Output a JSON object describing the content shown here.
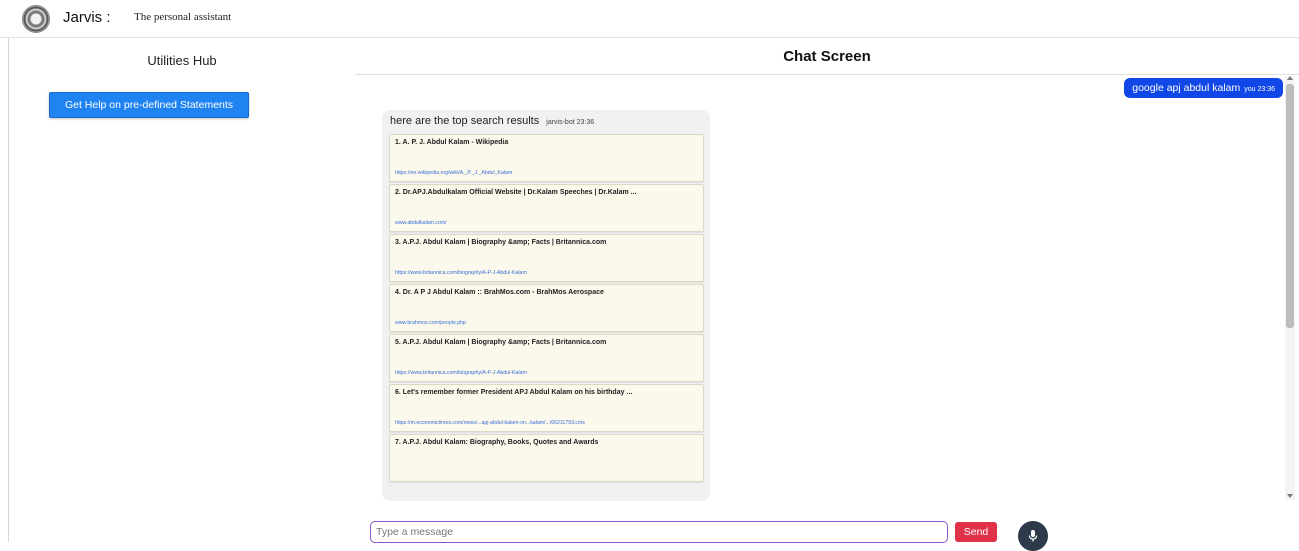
{
  "header": {
    "app_name": "Jarvis",
    "separator": ":",
    "subtitle": "The personal assistant",
    "logo_icon": "circular-seal-logo"
  },
  "sidebar": {
    "title": "Utilities Hub",
    "help_button_label": "Get Help on pre-defined Statements"
  },
  "chat": {
    "title": "Chat Screen",
    "user_message": {
      "text": "google apj abdul kalam",
      "sender_time": "you 23:36"
    },
    "bot_message": {
      "text": "here are the top search results",
      "sender_time": "jarvis-bot 23:36",
      "results": [
        {
          "title": "1. A. P. J. Abdul Kalam - Wikipedia",
          "url": "https://en.wikipedia.org/wiki/A._P._J._Abdul_Kalam"
        },
        {
          "title": "2. Dr.APJ.Abdulkalam Official Website | Dr.Kalam Speeches | Dr.Kalam ...",
          "url": "www.abdulkalam.com/"
        },
        {
          "title": "3. A.P.J. Abdul Kalam | Biography &amp; Facts | Britannica.com",
          "url": "https://www.britannica.com/biography/A-P-J-Abdul-Kalam"
        },
        {
          "title": "4. Dr. A P J Abdul Kalam :: BrahMos.com - BrahMos Aerospace",
          "url": "www.brahmos.com/people.php"
        },
        {
          "title": "5. A.P.J. Abdul Kalam | Biography &amp; Facts | Britannica.com",
          "url": "https://www.britannica.com/biography/A-P-J-Abdul-Kalam"
        },
        {
          "title": "6. Let's remember former President APJ Abdul Kalam on his birthday ...",
          "url": "https://m.economictimes.com/news/...apj-abdul-kalam-on...kalam/.../66211793.cms"
        },
        {
          "title": "7. A.P.J. Abdul Kalam: Biography, Books, Quotes and Awards",
          "url": ""
        }
      ]
    },
    "input_placeholder": "Type a message",
    "send_label": "Send",
    "mic_icon": "microphone-icon"
  },
  "colors": {
    "user_bubble": "#1047e6",
    "help_button": "#1f83f2",
    "send_button": "#e0334a",
    "mic_button": "#2c3a49",
    "result_card": "#fbf8ec",
    "link": "#3b6fd6",
    "input_border": "#8b55c9"
  }
}
